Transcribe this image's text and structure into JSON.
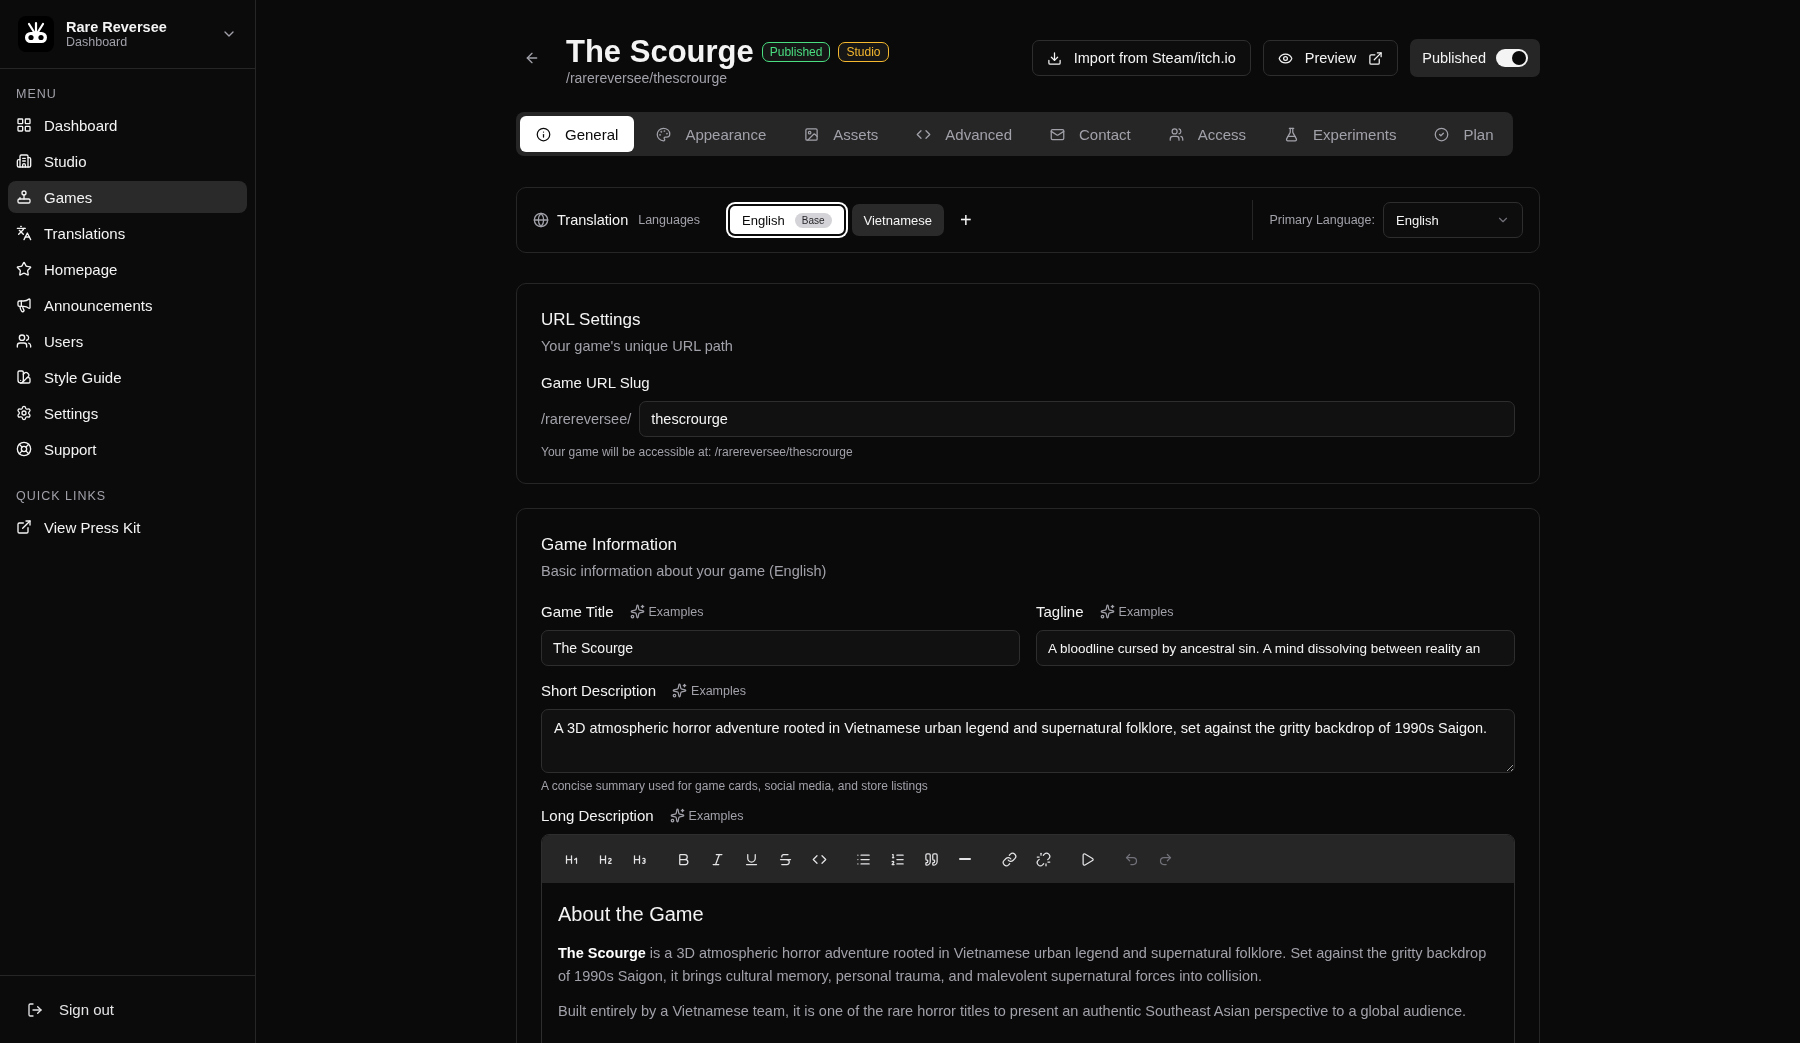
{
  "workspace": {
    "name": "Rare Reversee",
    "subtitle": "Dashboard"
  },
  "sidebar": {
    "menu_heading": "MENU",
    "items": [
      {
        "label": "Dashboard",
        "selected": false
      },
      {
        "label": "Studio",
        "selected": false
      },
      {
        "label": "Games",
        "selected": true
      },
      {
        "label": "Translations",
        "selected": false
      },
      {
        "label": "Homepage",
        "selected": false
      },
      {
        "label": "Announcements",
        "selected": false
      },
      {
        "label": "Users",
        "selected": false
      },
      {
        "label": "Style Guide",
        "selected": false
      },
      {
        "label": "Settings",
        "selected": false
      },
      {
        "label": "Support",
        "selected": false
      }
    ],
    "quick_links_heading": "QUICK LINKS",
    "quick_links": [
      {
        "label": "View Press Kit"
      }
    ],
    "sign_out": "Sign out"
  },
  "header": {
    "title": "The Scourge",
    "badges": [
      {
        "label": "Published",
        "color": "#4ade80"
      },
      {
        "label": "Studio",
        "color": "#f5b82e"
      }
    ],
    "path": "/rarereversee/thescrourge",
    "import_button": "Import from Steam/itch.io",
    "preview_button": "Preview",
    "publish_toggle": {
      "label": "Published",
      "on": true
    }
  },
  "tabs": [
    {
      "label": "General",
      "selected": true
    },
    {
      "label": "Appearance",
      "selected": false
    },
    {
      "label": "Assets",
      "selected": false
    },
    {
      "label": "Advanced",
      "selected": false
    },
    {
      "label": "Contact",
      "selected": false
    },
    {
      "label": "Access",
      "selected": false
    },
    {
      "label": "Experiments",
      "selected": false
    },
    {
      "label": "Plan",
      "selected": false
    }
  ],
  "translation": {
    "title": "Translation",
    "subtitle": "Languages",
    "languages": [
      {
        "label": "English",
        "badge": "Base",
        "selected": true
      },
      {
        "label": "Vietnamese",
        "selected": false
      }
    ],
    "add_button": "+",
    "primary_label": "Primary Language:",
    "primary_value": "English"
  },
  "url_settings": {
    "title": "URL Settings",
    "description": "Your game's unique URL path",
    "slug_label": "Game URL Slug",
    "prefix": "/rarereversee/",
    "slug_value": "thescrourge",
    "hint": "Your game will be accessible at: /rarereversee/thescrourge"
  },
  "game_information": {
    "title": "Game Information",
    "description": "Basic information about your game (English)",
    "game_title": {
      "label": "Game Title",
      "examples_label": "Examples",
      "value": "The Scourge"
    },
    "tagline": {
      "label": "Tagline",
      "examples_label": "Examples",
      "value": "A bloodline cursed by ancestral sin. A mind dissolving between reality an"
    },
    "short_description": {
      "label": "Short Description",
      "examples_label": "Examples",
      "value": "A 3D atmospheric horror adventure rooted in Vietnamese urban legend and supernatural folklore, set against the gritty backdrop of 1990s Saigon.",
      "hint": "A concise summary used for game cards, social media, and store listings"
    },
    "long_description": {
      "label": "Long Description",
      "examples_label": "Examples",
      "toolbar": [
        {
          "disabled": false
        },
        {
          "disabled": false
        },
        {
          "disabled": false
        },
        {
          "disabled": false
        },
        {
          "disabled": false
        },
        {
          "disabled": false
        },
        {
          "disabled": false
        },
        {
          "disabled": false
        },
        {
          "disabled": false
        },
        {
          "disabled": false
        },
        {
          "disabled": false
        },
        {
          "disabled": false
        },
        {
          "disabled": false
        },
        {
          "disabled": false
        },
        {
          "disabled": false
        },
        {
          "disabled": true
        },
        {
          "disabled": true
        }
      ],
      "heading": "About the Game",
      "paragraphs": [
        "**The Scourge** is a 3D atmospheric horror adventure rooted in Vietnamese urban legend and supernatural folklore. Set against the gritty backdrop of 1990s Saigon, it brings cultural memory, personal trauma, and malevolent supernatural forces into collision.",
        "Built entirely by a Vietnamese team, it is one of the rare horror titles to present an authentic Southeast Asian perspective to a global audience."
      ]
    }
  }
}
